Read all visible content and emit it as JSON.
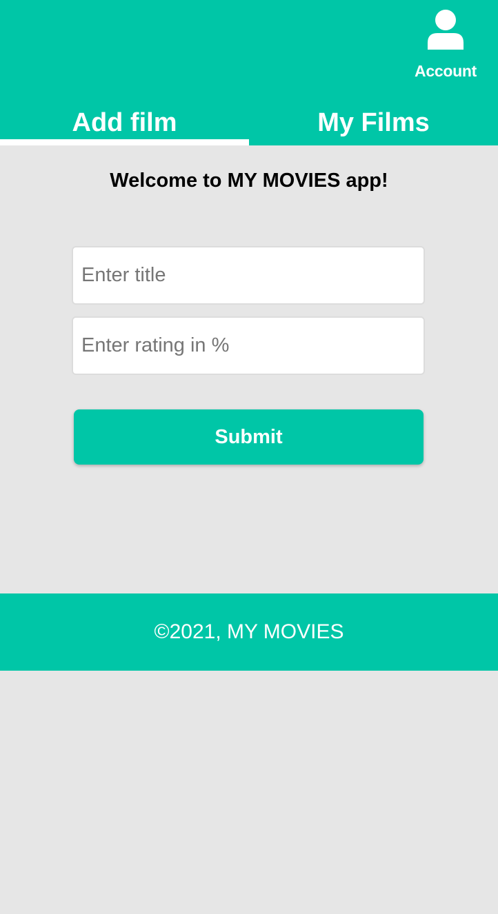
{
  "colors": {
    "accent": "#00c6a7",
    "background": "#e6e6e6",
    "text_on_accent": "#ffffff"
  },
  "header": {
    "account": {
      "icon": "user-icon",
      "label": "Account"
    },
    "tabs": [
      {
        "label": "Add film",
        "active": true
      },
      {
        "label": "My Films",
        "active": false
      }
    ]
  },
  "main": {
    "welcome": "Welcome to MY MOVIES app!",
    "form": {
      "title_placeholder": "Enter title",
      "title_value": "",
      "rating_placeholder": "Enter rating in %",
      "rating_value": "",
      "submit_label": "Submit"
    }
  },
  "footer": {
    "text": "©2021, MY MOVIES"
  }
}
